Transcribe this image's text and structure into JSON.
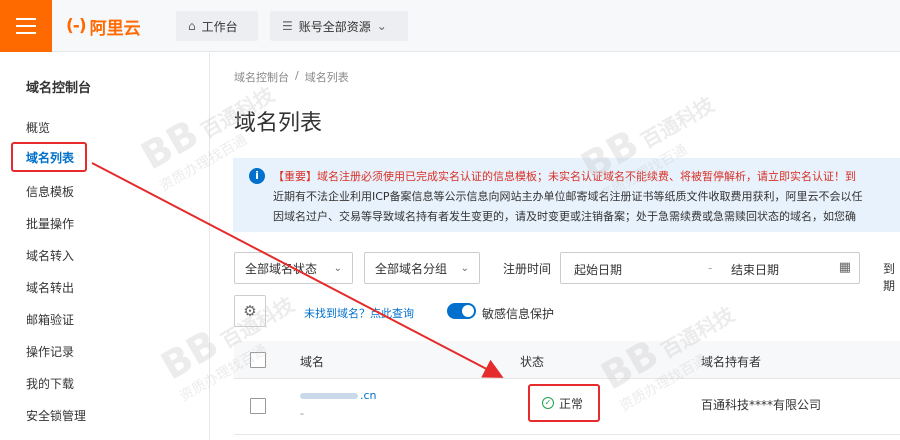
{
  "header": {
    "logo_text": "阿里云",
    "logo_mark": "(-)",
    "workbench_label": "工作台",
    "resources_label": "账号全部资源"
  },
  "sidebar": {
    "title": "域名控制台",
    "items": [
      {
        "label": "概览"
      },
      {
        "label": "域名列表"
      },
      {
        "label": "信息模板"
      },
      {
        "label": "批量操作"
      },
      {
        "label": "域名转入"
      },
      {
        "label": "域名转出"
      },
      {
        "label": "邮箱验证"
      },
      {
        "label": "操作记录"
      },
      {
        "label": "我的下载"
      },
      {
        "label": "安全锁管理"
      }
    ]
  },
  "breadcrumb": [
    "域名控制台",
    "/",
    "域名列表"
  ],
  "page_title": "域名列表",
  "notice": {
    "line1_prefix": "【重要】",
    "line1_text": "域名注册必须使用已完成实名认证的信息模板；未实名认证域名不能续费、将被暂停解析，请立即实名认证！到",
    "line2": "近期有不法企业利用ICP备案信息等公示信息向网站主办单位邮寄域名注册证书等纸质文件收取费用获利，阿里云不会以任",
    "line3": "因域名过户、交易等导致域名持有者发生变更的，请及时变更或注销备案；处于急需续费或急需赎回状态的域名，如您确"
  },
  "filters": {
    "status_select": "全部域名状态",
    "group_select": "全部域名分组",
    "time_label": "注册时间",
    "start_placeholder": "起始日期",
    "range_sep": "-",
    "end_placeholder": "结束日期",
    "cut_label": "到期"
  },
  "toolbar": {
    "link_text": "未找到域名？点此查询",
    "toggle_label": "敏感信息保护",
    "toggle_on": true
  },
  "table": {
    "headers": [
      "域名",
      "状态",
      "域名持有者"
    ],
    "rows": [
      {
        "domain_suffix": ".cn",
        "domain_sub": "-",
        "status": "正常",
        "owner": "百通科技****有限公司"
      }
    ]
  },
  "watermark": {
    "logo": "BB",
    "line1": "百通科技",
    "line2": "资质办理找百通"
  },
  "colors": {
    "brand": "#ff6a00",
    "link": "#0070cc",
    "highlight": "#e52b2b",
    "success": "#1fa34a",
    "notice_bg": "#e8f2fc"
  }
}
